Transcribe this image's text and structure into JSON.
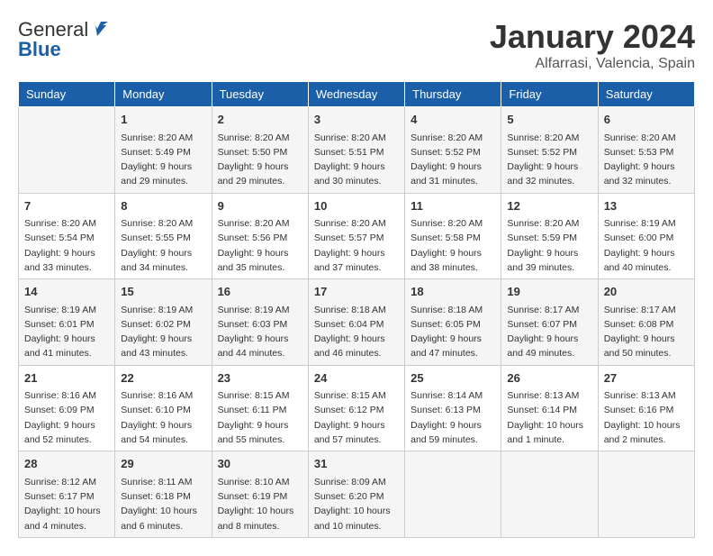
{
  "header": {
    "logo_general": "General",
    "logo_blue": "Blue",
    "month_title": "January 2024",
    "location": "Alfarrasi, Valencia, Spain"
  },
  "calendar": {
    "columns": [
      "Sunday",
      "Monday",
      "Tuesday",
      "Wednesday",
      "Thursday",
      "Friday",
      "Saturday"
    ],
    "rows": [
      [
        {
          "day": "",
          "info": ""
        },
        {
          "day": "1",
          "info": "Sunrise: 8:20 AM\nSunset: 5:49 PM\nDaylight: 9 hours\nand 29 minutes."
        },
        {
          "day": "2",
          "info": "Sunrise: 8:20 AM\nSunset: 5:50 PM\nDaylight: 9 hours\nand 29 minutes."
        },
        {
          "day": "3",
          "info": "Sunrise: 8:20 AM\nSunset: 5:51 PM\nDaylight: 9 hours\nand 30 minutes."
        },
        {
          "day": "4",
          "info": "Sunrise: 8:20 AM\nSunset: 5:52 PM\nDaylight: 9 hours\nand 31 minutes."
        },
        {
          "day": "5",
          "info": "Sunrise: 8:20 AM\nSunset: 5:52 PM\nDaylight: 9 hours\nand 32 minutes."
        },
        {
          "day": "6",
          "info": "Sunrise: 8:20 AM\nSunset: 5:53 PM\nDaylight: 9 hours\nand 32 minutes."
        }
      ],
      [
        {
          "day": "7",
          "info": "Sunrise: 8:20 AM\nSunset: 5:54 PM\nDaylight: 9 hours\nand 33 minutes."
        },
        {
          "day": "8",
          "info": "Sunrise: 8:20 AM\nSunset: 5:55 PM\nDaylight: 9 hours\nand 34 minutes."
        },
        {
          "day": "9",
          "info": "Sunrise: 8:20 AM\nSunset: 5:56 PM\nDaylight: 9 hours\nand 35 minutes."
        },
        {
          "day": "10",
          "info": "Sunrise: 8:20 AM\nSunset: 5:57 PM\nDaylight: 9 hours\nand 37 minutes."
        },
        {
          "day": "11",
          "info": "Sunrise: 8:20 AM\nSunset: 5:58 PM\nDaylight: 9 hours\nand 38 minutes."
        },
        {
          "day": "12",
          "info": "Sunrise: 8:20 AM\nSunset: 5:59 PM\nDaylight: 9 hours\nand 39 minutes."
        },
        {
          "day": "13",
          "info": "Sunrise: 8:19 AM\nSunset: 6:00 PM\nDaylight: 9 hours\nand 40 minutes."
        }
      ],
      [
        {
          "day": "14",
          "info": "Sunrise: 8:19 AM\nSunset: 6:01 PM\nDaylight: 9 hours\nand 41 minutes."
        },
        {
          "day": "15",
          "info": "Sunrise: 8:19 AM\nSunset: 6:02 PM\nDaylight: 9 hours\nand 43 minutes."
        },
        {
          "day": "16",
          "info": "Sunrise: 8:19 AM\nSunset: 6:03 PM\nDaylight: 9 hours\nand 44 minutes."
        },
        {
          "day": "17",
          "info": "Sunrise: 8:18 AM\nSunset: 6:04 PM\nDaylight: 9 hours\nand 46 minutes."
        },
        {
          "day": "18",
          "info": "Sunrise: 8:18 AM\nSunset: 6:05 PM\nDaylight: 9 hours\nand 47 minutes."
        },
        {
          "day": "19",
          "info": "Sunrise: 8:17 AM\nSunset: 6:07 PM\nDaylight: 9 hours\nand 49 minutes."
        },
        {
          "day": "20",
          "info": "Sunrise: 8:17 AM\nSunset: 6:08 PM\nDaylight: 9 hours\nand 50 minutes."
        }
      ],
      [
        {
          "day": "21",
          "info": "Sunrise: 8:16 AM\nSunset: 6:09 PM\nDaylight: 9 hours\nand 52 minutes."
        },
        {
          "day": "22",
          "info": "Sunrise: 8:16 AM\nSunset: 6:10 PM\nDaylight: 9 hours\nand 54 minutes."
        },
        {
          "day": "23",
          "info": "Sunrise: 8:15 AM\nSunset: 6:11 PM\nDaylight: 9 hours\nand 55 minutes."
        },
        {
          "day": "24",
          "info": "Sunrise: 8:15 AM\nSunset: 6:12 PM\nDaylight: 9 hours\nand 57 minutes."
        },
        {
          "day": "25",
          "info": "Sunrise: 8:14 AM\nSunset: 6:13 PM\nDaylight: 9 hours\nand 59 minutes."
        },
        {
          "day": "26",
          "info": "Sunrise: 8:13 AM\nSunset: 6:14 PM\nDaylight: 10 hours\nand 1 minute."
        },
        {
          "day": "27",
          "info": "Sunrise: 8:13 AM\nSunset: 6:16 PM\nDaylight: 10 hours\nand 2 minutes."
        }
      ],
      [
        {
          "day": "28",
          "info": "Sunrise: 8:12 AM\nSunset: 6:17 PM\nDaylight: 10 hours\nand 4 minutes."
        },
        {
          "day": "29",
          "info": "Sunrise: 8:11 AM\nSunset: 6:18 PM\nDaylight: 10 hours\nand 6 minutes."
        },
        {
          "day": "30",
          "info": "Sunrise: 8:10 AM\nSunset: 6:19 PM\nDaylight: 10 hours\nand 8 minutes."
        },
        {
          "day": "31",
          "info": "Sunrise: 8:09 AM\nSunset: 6:20 PM\nDaylight: 10 hours\nand 10 minutes."
        },
        {
          "day": "",
          "info": ""
        },
        {
          "day": "",
          "info": ""
        },
        {
          "day": "",
          "info": ""
        }
      ]
    ]
  }
}
